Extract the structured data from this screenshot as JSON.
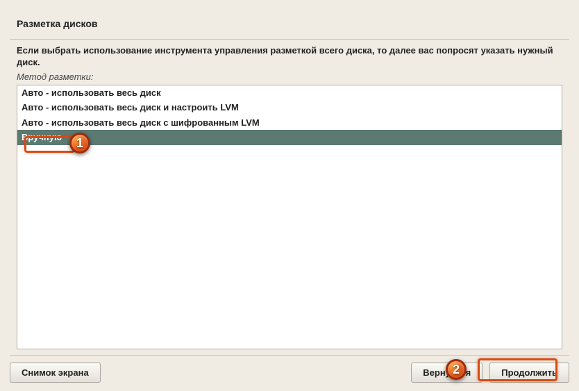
{
  "window": {
    "title": "Разметка дисков"
  },
  "instruction": "Если выбрать использование инструмента управления разметкой всего диска, то далее вас попросят указать нужный диск.",
  "method_label": "Метод разметки:",
  "options": [
    {
      "label": "Авто - использовать весь диск",
      "selected": false
    },
    {
      "label": "Авто - использовать весь диск и настроить LVM",
      "selected": false
    },
    {
      "label": "Авто - использовать весь диск с шифрованным LVM",
      "selected": false
    },
    {
      "label": "Вручную",
      "selected": true
    }
  ],
  "buttons": {
    "screenshot": "Снимок экрана",
    "back": "Вернуться",
    "continue": "Продолжить"
  },
  "annotations": {
    "badge1": "1",
    "badge2": "2"
  }
}
